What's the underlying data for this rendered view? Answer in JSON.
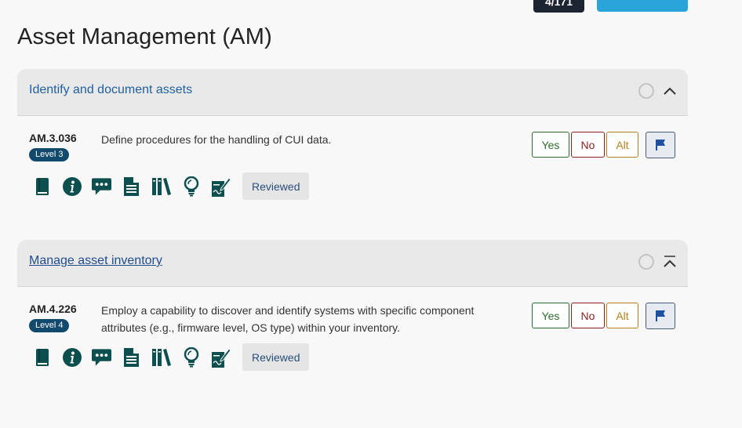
{
  "top": {
    "counter": "4/171"
  },
  "page_title": "Asset Management (AM)",
  "sections": [
    {
      "title": "Identify and document assets",
      "items": [
        {
          "id": "AM.3.036",
          "level": "Level 3",
          "text": "Define procedures for the handling of CUI data.",
          "answers": {
            "yes": "Yes",
            "no": "No",
            "alt": "Alt"
          },
          "reviewed": "Reviewed"
        }
      ]
    },
    {
      "title": "Manage asset inventory",
      "items": [
        {
          "id": "AM.4.226",
          "level": "Level 4",
          "text": "Employ a capability to discover and identify systems with specific component attributes (e.g., firmware level, OS type) within your inventory.",
          "answers": {
            "yes": "Yes",
            "no": "No",
            "alt": "Alt"
          },
          "reviewed": "Reviewed"
        }
      ]
    }
  ],
  "icons": [
    "book-icon",
    "info-icon",
    "comment-icon",
    "document-icon",
    "library-icon",
    "lightbulb-icon",
    "sign-icon",
    "flag-icon",
    "chevron-up-icon"
  ],
  "colors": {
    "icon": "#0d4f4f",
    "level_badge": "#124a6e",
    "yes": "#2d6a2d",
    "no": "#8b1e1e",
    "alt": "#b08220",
    "title_link": "#1f5f9f",
    "top_button": "#2aa4d9"
  }
}
